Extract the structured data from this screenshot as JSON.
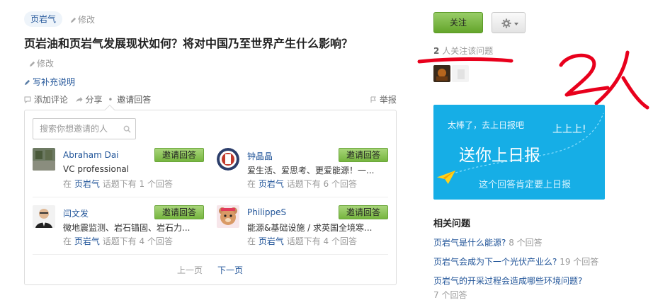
{
  "question": {
    "topic_tag": "页岩气",
    "edit_label": "修改",
    "title": "页岩油和页岩气发展现状如何？将对中国乃至世界产生什么影响？",
    "title_edit_label": "修改",
    "add_description": "写补充说明"
  },
  "actions": {
    "comment": "添加评论",
    "share": "分享",
    "separator": "•",
    "invite": "邀请回答",
    "report": "举报"
  },
  "invite_panel": {
    "search_placeholder": "搜索你想邀请的人",
    "candidates": [
      {
        "name": "Abraham Dai",
        "desc": "VC professional",
        "meta_prefix": "在",
        "topic": "页岩气",
        "meta_suffix": "话题下有 1 个回答",
        "button": "邀请回答"
      },
      {
        "name": "钟晶晶",
        "desc": "爱生活、爱思考、更爱能源！一...",
        "meta_prefix": "在",
        "topic": "页岩气",
        "meta_suffix": "话题下有 6 个回答",
        "button": "邀请回答"
      },
      {
        "name": "闫文发",
        "desc": "微地震监测、岩石锚固、岩石力...",
        "meta_prefix": "在",
        "topic": "页岩气",
        "meta_suffix": "话题下有 4 个回答",
        "button": "邀请回答"
      },
      {
        "name": "PhilippeS",
        "desc": "能源&基础设施 / 求英国全境寒...",
        "meta_prefix": "在",
        "topic": "页岩气",
        "meta_suffix": "话题下有 4 个回答",
        "button": "邀请回答"
      }
    ],
    "prev_page": "上一页",
    "next_page": "下一页"
  },
  "sidebar": {
    "follow_button": "关注",
    "followers_count": "2",
    "followers_text": "人关注该问题",
    "handwritten_annotation": "2人",
    "banner": {
      "line1": "太棒了，去上日报吧",
      "line2": "上上上!",
      "headline": "送你上日报",
      "line3": "这个回答肯定要上日报"
    },
    "related_title": "相关问题",
    "related": [
      {
        "title": "页岩气是什么能源?",
        "count": "8 个回答"
      },
      {
        "title": "页岩气会成为下一个光伏产业么?",
        "count": "19 个回答"
      },
      {
        "title": "页岩气的开采过程会造成哪些环境问题?",
        "count": "7 个回答"
      }
    ]
  },
  "colors": {
    "link": "#225599",
    "green_button": "#76b53f",
    "banner_blue": "#16aee6",
    "annotation_red": "#e8001c"
  }
}
